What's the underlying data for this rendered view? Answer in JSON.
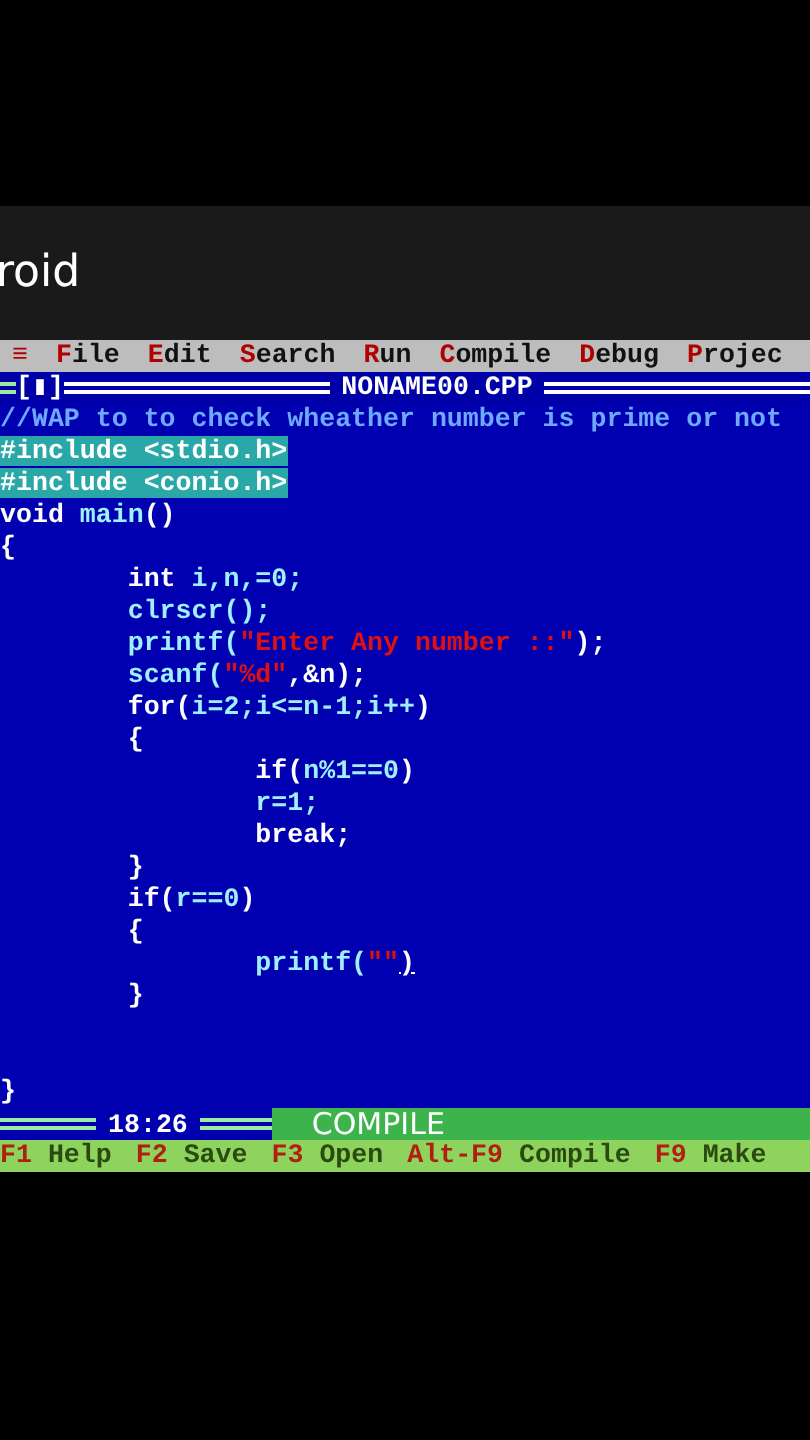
{
  "header": {
    "title": "roid"
  },
  "menu": [
    {
      "hotkey": "≡"
    },
    {
      "hotkey": "F",
      "rest": "ile"
    },
    {
      "hotkey": "E",
      "rest": "dit"
    },
    {
      "hotkey": "S",
      "rest": "earch"
    },
    {
      "hotkey": "R",
      "rest": "un"
    },
    {
      "hotkey": "C",
      "rest": "ompile"
    },
    {
      "hotkey": "D",
      "rest": "ebug"
    },
    {
      "hotkey": "P",
      "rest": "rojec"
    }
  ],
  "editor": {
    "close_box": "[▮]",
    "file_name": "NONAME00.CPP",
    "lines": [
      {
        "segments": [
          {
            "kind": "comment",
            "text": "//WAP to to check wheather number is prime or not"
          }
        ]
      },
      {
        "segments": [
          {
            "kind": "include",
            "text": "#include <stdio.h>"
          }
        ]
      },
      {
        "segments": [
          {
            "kind": "include",
            "text": "#include <conio.h>"
          }
        ]
      },
      {
        "segments": [
          {
            "kind": "keyword",
            "text": "void "
          },
          {
            "kind": "ident",
            "text": "main"
          },
          {
            "kind": "keyword",
            "text": "()"
          }
        ]
      },
      {
        "segments": [
          {
            "kind": "keyword",
            "text": "{"
          }
        ]
      },
      {
        "segments": [
          {
            "kind": "keyword",
            "text": "        int "
          },
          {
            "kind": "ident",
            "text": "i,n,=0;"
          }
        ]
      },
      {
        "segments": [
          {
            "kind": "ident",
            "text": "        clrscr();"
          }
        ]
      },
      {
        "segments": [
          {
            "kind": "ident",
            "text": "        printf("
          },
          {
            "kind": "string",
            "text": "\"Enter Any number ::\""
          },
          {
            "kind": "keyword",
            "text": ");"
          }
        ]
      },
      {
        "segments": [
          {
            "kind": "ident",
            "text": "        scanf("
          },
          {
            "kind": "string",
            "text": "\"%d\""
          },
          {
            "kind": "keyword",
            "text": ",&n);"
          }
        ]
      },
      {
        "segments": [
          {
            "kind": "keyword",
            "text": "        for("
          },
          {
            "kind": "ident",
            "text": "i=2;i<=n-1;i++"
          },
          {
            "kind": "keyword",
            "text": ")"
          }
        ]
      },
      {
        "segments": [
          {
            "kind": "keyword",
            "text": "        {"
          }
        ]
      },
      {
        "segments": [
          {
            "kind": "keyword",
            "text": "                if("
          },
          {
            "kind": "ident",
            "text": "n%1==0"
          },
          {
            "kind": "keyword",
            "text": ")"
          }
        ]
      },
      {
        "segments": [
          {
            "kind": "ident",
            "text": "                r=1;"
          }
        ]
      },
      {
        "segments": [
          {
            "kind": "keyword",
            "text": "                break;"
          }
        ]
      },
      {
        "segments": [
          {
            "kind": "keyword",
            "text": "        }"
          }
        ]
      },
      {
        "segments": [
          {
            "kind": "keyword",
            "text": "        if("
          },
          {
            "kind": "ident",
            "text": "r==0"
          },
          {
            "kind": "keyword",
            "text": ")"
          }
        ]
      },
      {
        "segments": [
          {
            "kind": "keyword",
            "text": "        {"
          }
        ]
      },
      {
        "segments": [
          {
            "kind": "ident",
            "text": "                printf("
          },
          {
            "kind": "string",
            "text": "\"\""
          },
          {
            "kind": "cursor",
            "text": ")"
          }
        ]
      },
      {
        "segments": [
          {
            "kind": "keyword",
            "text": "        }"
          }
        ]
      },
      {
        "segments": [
          {
            "kind": "keyword",
            "text": "}"
          }
        ]
      }
    ],
    "position": "18:26"
  },
  "caption": "COMPILE",
  "function_keys": [
    {
      "key": "F1",
      "label": "Help"
    },
    {
      "key": "F2",
      "label": "Save"
    },
    {
      "key": "F3",
      "label": "Open"
    },
    {
      "key": "Alt-F9",
      "label": "Compile"
    },
    {
      "key": "F9",
      "label": "Make"
    }
  ]
}
